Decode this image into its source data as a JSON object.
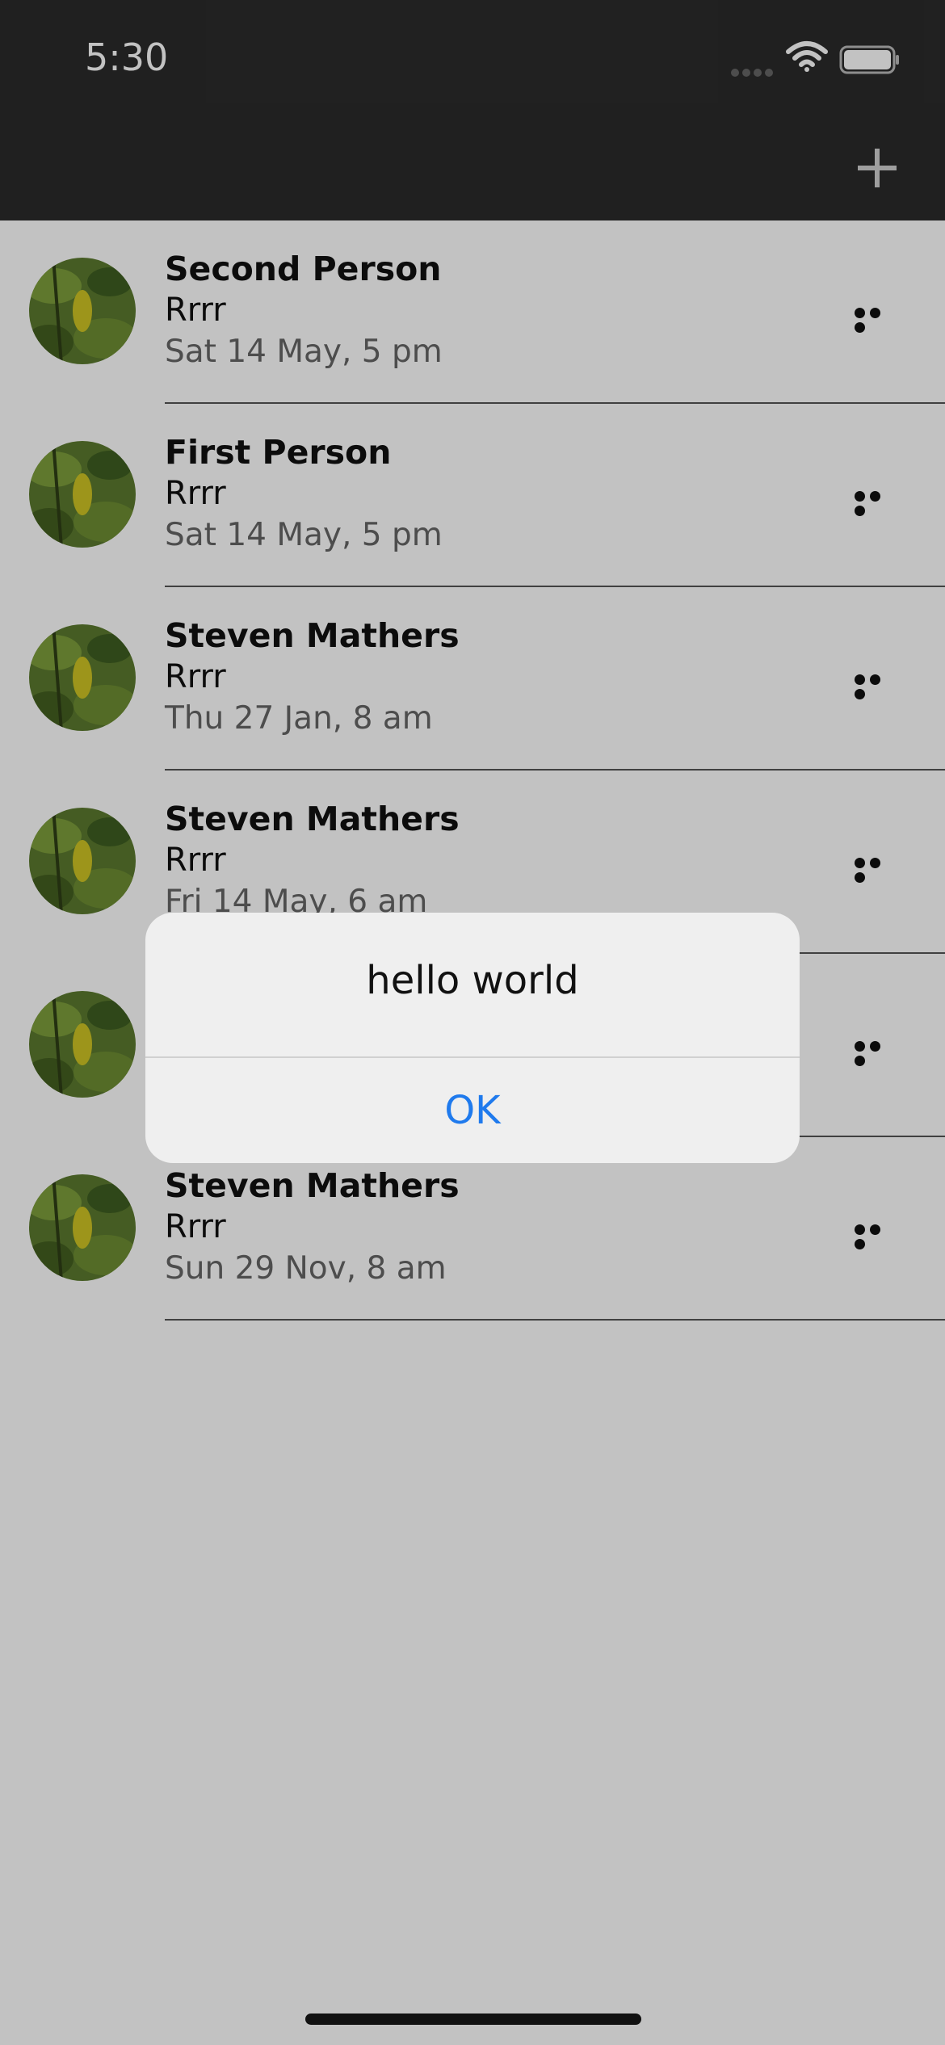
{
  "status_bar": {
    "time": "5:30",
    "icons": [
      "signal-dots-icon",
      "wifi-icon",
      "battery-icon"
    ]
  },
  "nav_bar": {
    "icons": [
      "plus-icon"
    ]
  },
  "list": {
    "items": [
      {
        "name": "Second Person",
        "message": "Rrrr",
        "date": "Sat 14 May, 5 pm"
      },
      {
        "name": "First Person",
        "message": "Rrrr",
        "date": "Sat 14 May, 5 pm"
      },
      {
        "name": "Steven Mathers",
        "message": "Rrrr",
        "date": "Thu 27 Jan, 8 am"
      },
      {
        "name": "Steven Mathers",
        "message": "Rrrr",
        "date": "Fri 14 May, 6 am"
      },
      {
        "name": "",
        "message": "",
        "date": ""
      },
      {
        "name": "Steven Mathers",
        "message": "Rrrr",
        "date": "Sun 29 Nov, 8 am"
      }
    ]
  },
  "alert": {
    "title": "hello world",
    "ok_label": "OK"
  },
  "colors": {
    "bar": "#2b2b2b",
    "accent": "#1f7aed",
    "dim_overlay": "rgba(0,0,0,0.24)"
  }
}
